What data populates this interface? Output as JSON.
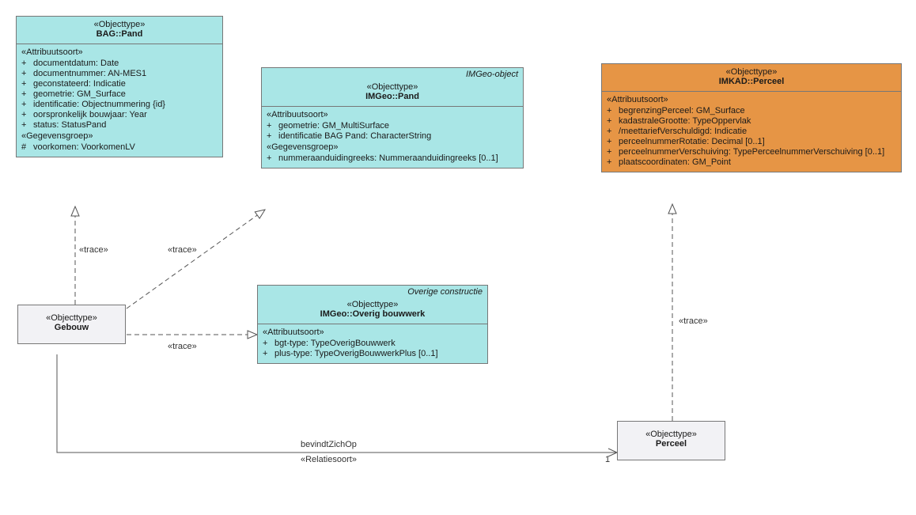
{
  "boxes": {
    "bag_pand": {
      "stereo": "«Objecttype»",
      "name": "BAG::Pand",
      "section1_label": "«Attribuutsoort»",
      "attrs1": [
        {
          "vis": "+",
          "text": "documentdatum: Date"
        },
        {
          "vis": "+",
          "text": "documentnummer: AN-MES1"
        },
        {
          "vis": "+",
          "text": "geconstateerd: Indicatie"
        },
        {
          "vis": "+",
          "text": "geometrie: GM_Surface"
        },
        {
          "vis": "+",
          "text": "identificatie: Objectnummering {id}"
        },
        {
          "vis": "+",
          "text": "oorspronkelijk bouwjaar: Year"
        },
        {
          "vis": "+",
          "text": "status: StatusPand"
        }
      ],
      "section2_label": "«Gegevensgroep»",
      "attrs2": [
        {
          "vis": "#",
          "text": "voorkomen: VoorkomenLV"
        }
      ]
    },
    "imgeo_pand": {
      "tagline": "IMGeo-object",
      "stereo": "«Objecttype»",
      "name": "IMGeo::Pand",
      "section1_label": "«Attribuutsoort»",
      "attrs1": [
        {
          "vis": "+",
          "text": "geometrie: GM_MultiSurface"
        },
        {
          "vis": "+",
          "text": "identificatie BAG Pand: CharacterString"
        }
      ],
      "section2_label": "«Gegevensgroep»",
      "attrs2": [
        {
          "vis": "+",
          "text": "nummeraanduidingreeks: Nummeraanduidingreeks [0..1]"
        }
      ]
    },
    "imgeo_overig": {
      "tagline": "Overige constructie",
      "stereo": "«Objecttype»",
      "name": "IMGeo::Overig bouwwerk",
      "section1_label": "«Attribuutsoort»",
      "attrs1": [
        {
          "vis": "+",
          "text": "bgt-type: TypeOverigBouwwerk"
        },
        {
          "vis": "+",
          "text": "plus-type: TypeOverigBouwwerkPlus [0..1]"
        }
      ]
    },
    "imkad_perceel": {
      "stereo": "«Objecttype»",
      "name": "IMKAD::Perceel",
      "section1_label": "«Attribuutsoort»",
      "attrs1": [
        {
          "vis": "+",
          "text": "begrenzingPerceel: GM_Surface"
        },
        {
          "vis": "+",
          "text": "kadastraleGrootte: TypeOppervlak"
        },
        {
          "vis": "+",
          "text": "/meettariefVerschuldigd: Indicatie"
        },
        {
          "vis": "+",
          "text": "perceelnummerRotatie: Decimal [0..1]"
        },
        {
          "vis": "+",
          "text": "perceelnummerVerschuiving: TypePerceelnummerVerschuiving [0..1]"
        },
        {
          "vis": "+",
          "text": "plaatscoordinaten: GM_Point"
        }
      ]
    },
    "gebouw": {
      "stereo": "«Objecttype»",
      "name": "Gebouw"
    },
    "perceel": {
      "stereo": "«Objecttype»",
      "name": "Perceel"
    }
  },
  "labels": {
    "trace": "«trace»",
    "relation_name": "bevindtZichOp",
    "relation_stereo": "«Relatiesoort»",
    "mult_one": "1"
  }
}
